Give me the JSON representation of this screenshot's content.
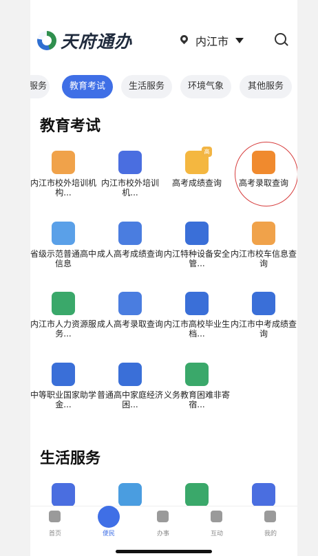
{
  "header": {
    "app_name": "天府通办",
    "location": "内江市"
  },
  "tabs": [
    {
      "label": "服务"
    },
    {
      "label": "教育考试",
      "active": true
    },
    {
      "label": "生活服务"
    },
    {
      "label": "环境气象"
    },
    {
      "label": "其他服务"
    }
  ],
  "education": {
    "title": "教育考试",
    "items": [
      {
        "label": "内江市校外培训机构...",
        "icon": "no-person-icon",
        "color": "#f0a24a"
      },
      {
        "label": "内江市校外培训机...",
        "icon": "person-icon",
        "color": "#4a6ee0"
      },
      {
        "label": "高考成绩查询",
        "icon": "exam-score-icon",
        "color": "#f4b740",
        "badge": "高"
      },
      {
        "label": "高考录取查询",
        "icon": "exam-admission-icon",
        "color": "#f08a2e"
      },
      {
        "label": "省级示范普通高中信息",
        "icon": "school-building-icon",
        "color": "#5aa0e8"
      },
      {
        "label": "成人高考成绩查询",
        "icon": "adult-exam-icon",
        "color": "#4a7de0"
      },
      {
        "label": "内江特种设备安全管...",
        "icon": "equipment-icon",
        "color": "#3a6fd8"
      },
      {
        "label": "内江市校车信息查询",
        "icon": "school-bus-icon",
        "color": "#f0a24a"
      },
      {
        "label": "内江市人力资源服务...",
        "icon": "hr-search-icon",
        "color": "#3aa86a"
      },
      {
        "label": "成人高考录取查询",
        "icon": "adult-admission-icon",
        "color": "#4a7de0"
      },
      {
        "label": "内江市高校毕业生档...",
        "icon": "graduate-file-icon",
        "color": "#3a6fd8"
      },
      {
        "label": "内江市中考成绩查询",
        "icon": "midterm-score-icon",
        "color": "#3a6fd8"
      },
      {
        "label": "中等职业国家助学金...",
        "icon": "aid-grant-icon",
        "color": "#3a6fd8"
      },
      {
        "label": "普通高中家庭经济困...",
        "icon": "finance-aid-icon",
        "color": "#3a6fd8"
      },
      {
        "label": "义务教育困难非寄宿...",
        "icon": "hand-aid-icon",
        "color": "#3aa86a"
      }
    ]
  },
  "life": {
    "title": "生活服务",
    "items": [
      {
        "icon": "water-drop-icon",
        "color": "#4a6ee0"
      },
      {
        "icon": "id-card-icon",
        "color": "#4a9de0"
      },
      {
        "icon": "globe-icon",
        "color": "#3aa86a"
      },
      {
        "icon": "reader-icon",
        "color": "#4a6ee0"
      }
    ]
  },
  "bottom_nav": [
    {
      "label": "首页",
      "icon": "home-icon"
    },
    {
      "label": "便民",
      "icon": "service-icon",
      "active": true
    },
    {
      "label": "办事",
      "icon": "document-icon"
    },
    {
      "label": "互动",
      "icon": "interact-icon"
    },
    {
      "label": "我的",
      "icon": "profile-icon"
    }
  ]
}
